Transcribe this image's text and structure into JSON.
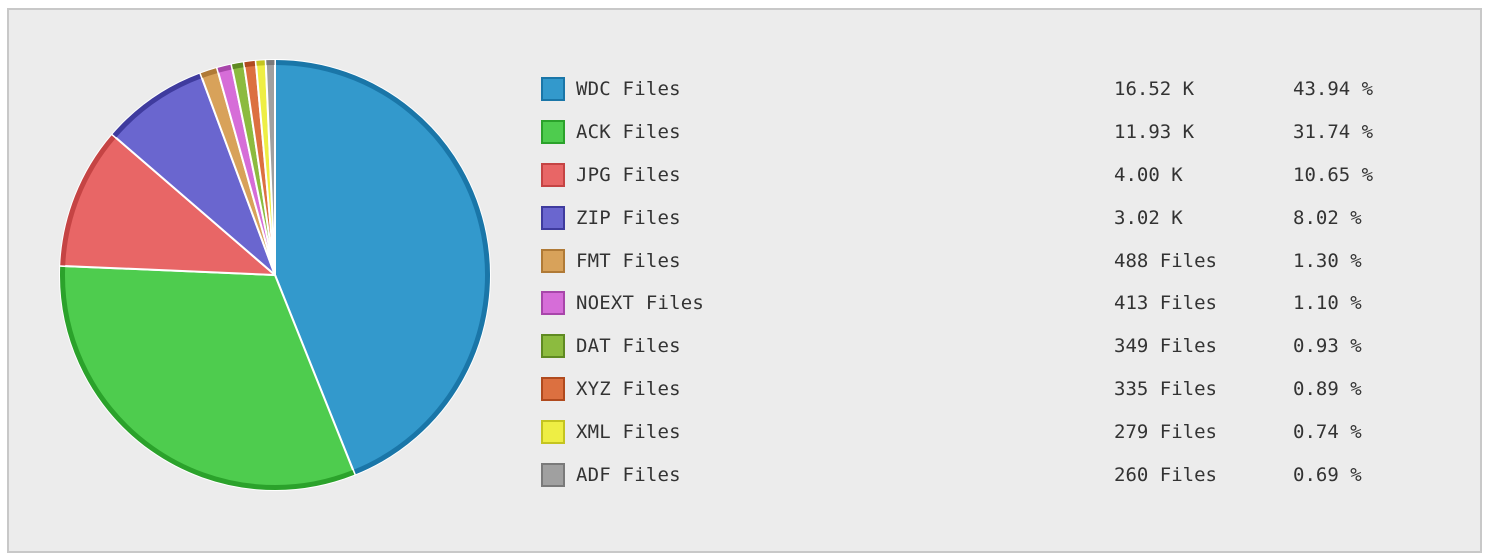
{
  "chart_data": {
    "type": "pie",
    "legend_position": "right",
    "slices": [
      {
        "label": "WDC Files",
        "count": "16.52 K",
        "percent_label": "43.94 %",
        "value": 43.94,
        "color": "#3399cc",
        "edge": "#1a76a8"
      },
      {
        "label": "ACK Files",
        "count": "11.93 K",
        "percent_label": "31.74 %",
        "value": 31.74,
        "color": "#4ecc4e",
        "edge": "#2ba22b"
      },
      {
        "label": "JPG Files",
        "count": "4.00 K",
        "percent_label": "10.65 %",
        "value": 10.65,
        "color": "#e86666",
        "edge": "#c54444"
      },
      {
        "label": "ZIP Files",
        "count": "3.02 K",
        "percent_label": "8.02 %",
        "value": 8.02,
        "color": "#6a66cf",
        "edge": "#3f3b9e"
      },
      {
        "label": "FMT Files",
        "count": "488 Files",
        "percent_label": "1.30 %",
        "value": 1.3,
        "color": "#d8a25a",
        "edge": "#b07a36"
      },
      {
        "label": "NOEXT Files",
        "count": "413 Files",
        "percent_label": "1.10 %",
        "value": 1.1,
        "color": "#d66dd8",
        "edge": "#a846aa"
      },
      {
        "label": "DAT Files",
        "count": "349 Files",
        "percent_label": "0.93 %",
        "value": 0.93,
        "color": "#8cbb3f",
        "edge": "#5f8a22"
      },
      {
        "label": "XYZ Files",
        "count": "335 Files",
        "percent_label": "0.89 %",
        "value": 0.89,
        "color": "#dc7040",
        "edge": "#b04a1e"
      },
      {
        "label": "XML Files",
        "count": "279 Files",
        "percent_label": "0.74 %",
        "value": 0.74,
        "color": "#eeee44",
        "edge": "#c4c420"
      },
      {
        "label": "ADF Files",
        "count": "260 Files",
        "percent_label": "0.69 %",
        "value": 0.69,
        "color": "#a0a0a0",
        "edge": "#7a7a7a"
      }
    ]
  }
}
